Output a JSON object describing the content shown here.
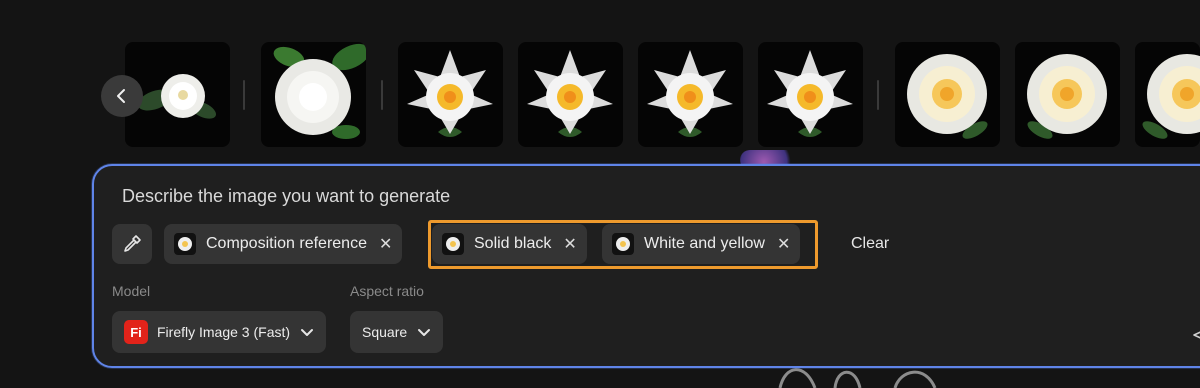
{
  "carousel": {
    "thumbnails": [
      {
        "name": "camellia-small"
      },
      {
        "name": "camellia-leaves"
      },
      {
        "name": "lotus-1"
      },
      {
        "name": "lotus-2"
      },
      {
        "name": "lotus-3"
      },
      {
        "name": "lotus-4"
      },
      {
        "name": "camellia-yellow-1"
      },
      {
        "name": "camellia-yellow-2"
      },
      {
        "name": "camellia-yellow-3"
      }
    ]
  },
  "prompt": {
    "placeholder": "Describe the image you want to generate"
  },
  "chips": [
    {
      "label": "Composition reference"
    },
    {
      "label": "Solid black"
    },
    {
      "label": "White and yellow"
    }
  ],
  "clear_label": "Clear",
  "model": {
    "label": "Model",
    "value": "Firefly Image 3 (Fast)",
    "badge": "Fi"
  },
  "aspect_ratio": {
    "label": "Aspect ratio",
    "value": "Square"
  },
  "colors": {
    "panel_border": "#5f84e8",
    "highlight": "#ee9a2d",
    "badge": "#e2231a"
  }
}
